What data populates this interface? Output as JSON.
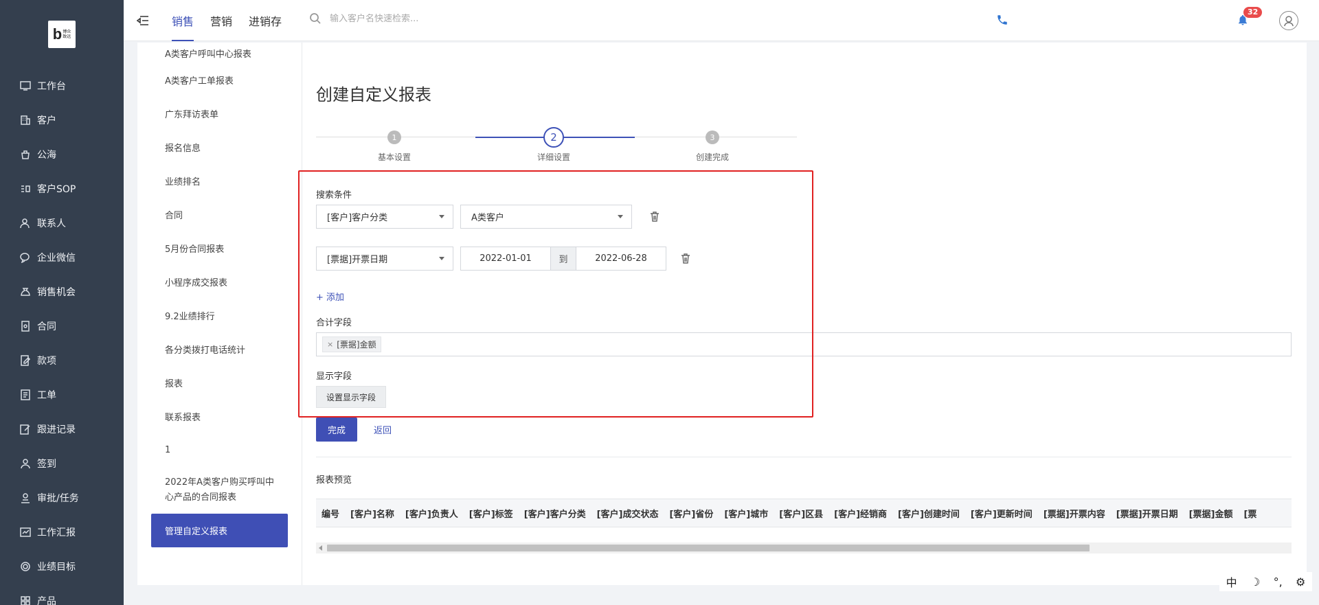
{
  "logo": {
    "letter": "b",
    "text": "博众\n致远"
  },
  "sidebar": {
    "items": [
      {
        "label": "工作台"
      },
      {
        "label": "客户"
      },
      {
        "label": "公海"
      },
      {
        "label": "客户SOP"
      },
      {
        "label": "联系人"
      },
      {
        "label": "企业微信"
      },
      {
        "label": "销售机会"
      },
      {
        "label": "合同"
      },
      {
        "label": "款项"
      },
      {
        "label": "工单"
      },
      {
        "label": "跟进记录"
      },
      {
        "label": "签到"
      },
      {
        "label": "审批/任务"
      },
      {
        "label": "工作汇报"
      },
      {
        "label": "业绩目标"
      },
      {
        "label": "产品"
      }
    ]
  },
  "topbar": {
    "tabs": [
      "销售",
      "营销",
      "进销存"
    ],
    "search_placeholder": "输入客户名快速检索...",
    "notification_count": "32"
  },
  "report_list": {
    "items": [
      "A类客户呼叫中心报表",
      "A类客户工单报表",
      "广东拜访表单",
      "报名信息",
      "业绩排名",
      "合同",
      "5月份合同报表",
      "小程序成交报表",
      "9.2业绩排行",
      "各分类拨打电话统计",
      "报表",
      "联系报表",
      "1",
      "2022年A类客户购买呼叫中心产品的合同报表",
      "管理自定义报表"
    ]
  },
  "main": {
    "title": "创建自定义报表",
    "steps": [
      {
        "num": "1",
        "label": "基本设置"
      },
      {
        "num": "2",
        "label": "详细设置"
      },
      {
        "num": "3",
        "label": "创建完成"
      }
    ],
    "search_conditions_label": "搜索条件",
    "condition1": {
      "field": "[客户]客户分类",
      "value": "A类客户"
    },
    "condition2": {
      "field": "[票据]开票日期",
      "from": "2022-01-01",
      "to_label": "到",
      "to": "2022-06-28"
    },
    "add_label": "+ 添加",
    "sum_fields_label": "合计字段",
    "sum_tag": "[票据]金额",
    "tag_remove": "×",
    "display_fields_label": "显示字段",
    "display_fields_button": "设置显示字段",
    "done_button": "完成",
    "back_link": "返回",
    "preview_label": "报表预览",
    "preview_columns": [
      "编号",
      "[客户]名称",
      "[客户]负责人",
      "[客户]标签",
      "[客户]客户分类",
      "[客户]成交状态",
      "[客户]省份",
      "[客户]城市",
      "[客户]区县",
      "[客户]经销商",
      "[客户]创建时间",
      "[客户]更新时间",
      "[票据]开票内容",
      "[票据]开票日期",
      "[票据]金额",
      "[票"
    ]
  },
  "ime": {
    "mode": "中",
    "moon": "☽",
    "punct": "°,",
    "gear": "⚙"
  },
  "colors": {
    "sidebar_bg": "#343f4e",
    "accent": "#3f4fb5",
    "highlight_border": "#e02020",
    "badge": "#e94b4b"
  }
}
